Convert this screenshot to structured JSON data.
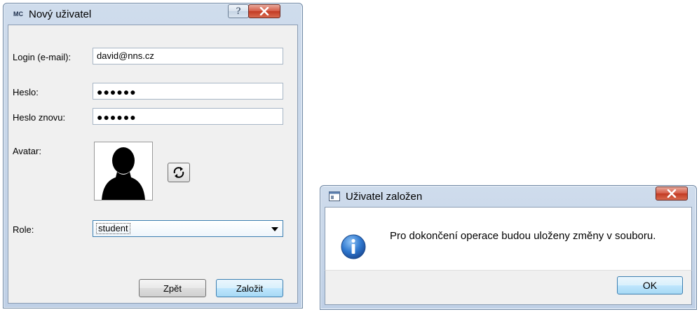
{
  "new_user_dialog": {
    "app_badge": "MC",
    "title": "Nový uživatel",
    "help_glyph": "?",
    "login_label": "Login (e-mail):",
    "login_value": "david@nns.cz",
    "password_label": "Heslo:",
    "password_value": "●●●●●●",
    "password_again_label": "Heslo znovu:",
    "password_again_value": "●●●●●●",
    "avatar_label": "Avatar:",
    "role_label": "Role:",
    "role_value": "student",
    "back_button": "Zpět",
    "create_button": "Založit",
    "icons": [
      "avatar-silhouette-icon",
      "refresh-icon",
      "help-icon",
      "close-icon",
      "dropdown-arrow-icon"
    ]
  },
  "message_dialog": {
    "title": "Uživatel založen",
    "message": "Pro dokončení operace budou uloženy změny v souboru.",
    "ok_button": "OK",
    "icons": [
      "window-icon",
      "info-icon",
      "close-icon"
    ]
  }
}
